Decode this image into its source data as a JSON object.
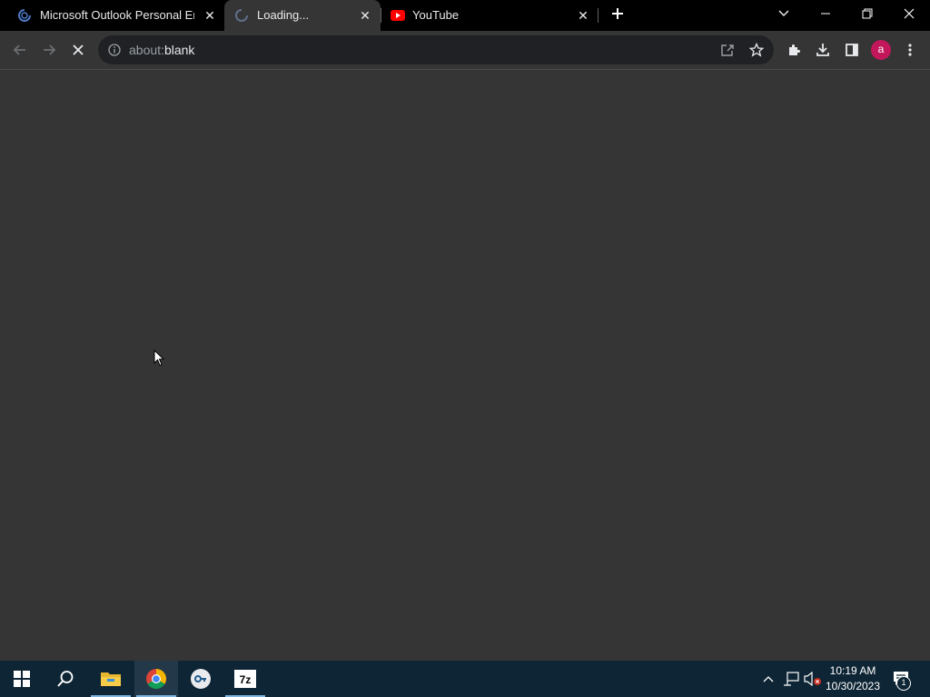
{
  "browser": {
    "tabs": [
      {
        "title": "Microsoft Outlook Personal Ema",
        "favicon": "outlook-loading-icon",
        "active": false
      },
      {
        "title": "Loading...",
        "favicon": "spinner-icon",
        "active": true
      },
      {
        "title": "YouTube",
        "favicon": "youtube-icon",
        "active": false
      }
    ],
    "address": {
      "prefix": "about:",
      "rest": "blank"
    },
    "profile_initial": "a"
  },
  "taskbar": {
    "time": "10:19 AM",
    "date": "10/30/2023",
    "notification_count": "1",
    "apps": [
      "windows-start-icon",
      "search-icon",
      "file-explorer-icon",
      "chrome-icon",
      "keepass-icon",
      "7zip-icon"
    ]
  },
  "colors": {
    "tab_bg": "#000000",
    "page_bg": "#353535",
    "taskbar_bg": "#0e2535",
    "avatar": "#c2185b",
    "youtube_red": "#ff0000"
  }
}
